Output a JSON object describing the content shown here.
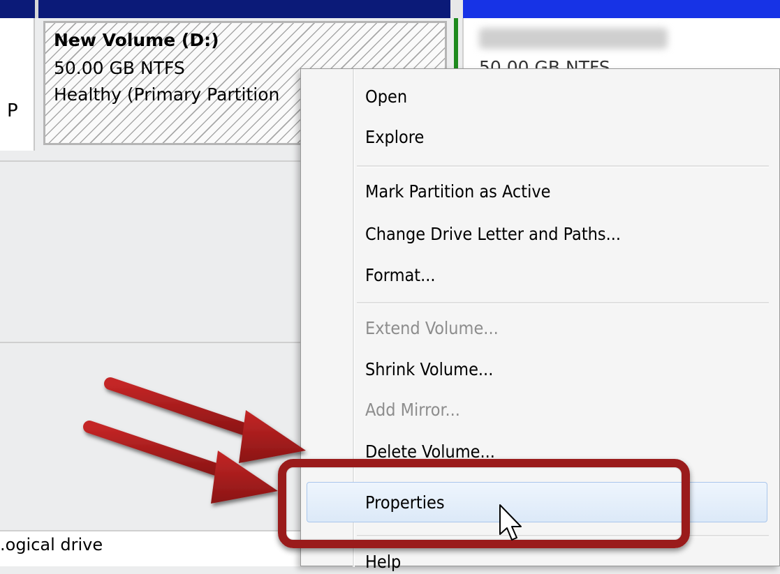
{
  "disk_view": {
    "left_partition_letter": "P",
    "selected_volume": {
      "name": "New Volume  (D:)",
      "size": "50.00 GB NTFS",
      "status": "Healthy (Primary Partition"
    },
    "right_volume": {
      "size": "50.00 GB NTFS"
    },
    "legend_label": ".ogical drive"
  },
  "context_menu": {
    "items": [
      {
        "label": "Open",
        "enabled": true
      },
      {
        "label": "Explore",
        "enabled": true
      },
      {
        "label": "Mark Partition as Active",
        "enabled": true
      },
      {
        "label": "Change Drive Letter and Paths...",
        "enabled": true
      },
      {
        "label": "Format...",
        "enabled": true
      },
      {
        "label": "Extend Volume...",
        "enabled": false
      },
      {
        "label": "Shrink Volume...",
        "enabled": true
      },
      {
        "label": "Add Mirror...",
        "enabled": false
      },
      {
        "label": "Delete Volume...",
        "enabled": true
      },
      {
        "label": "Properties",
        "enabled": true,
        "hovered": true
      },
      {
        "label": "Help",
        "enabled": true
      }
    ]
  },
  "annotation": {
    "highlight_color": "#9a1b1b",
    "arrow_color": "#a31a1a"
  },
  "colors": {
    "navy_bar": "#0b1a78",
    "blue_bar": "#1733e6",
    "green_selection": "#1e8a1e",
    "menu_hover": "#dce9f8"
  }
}
